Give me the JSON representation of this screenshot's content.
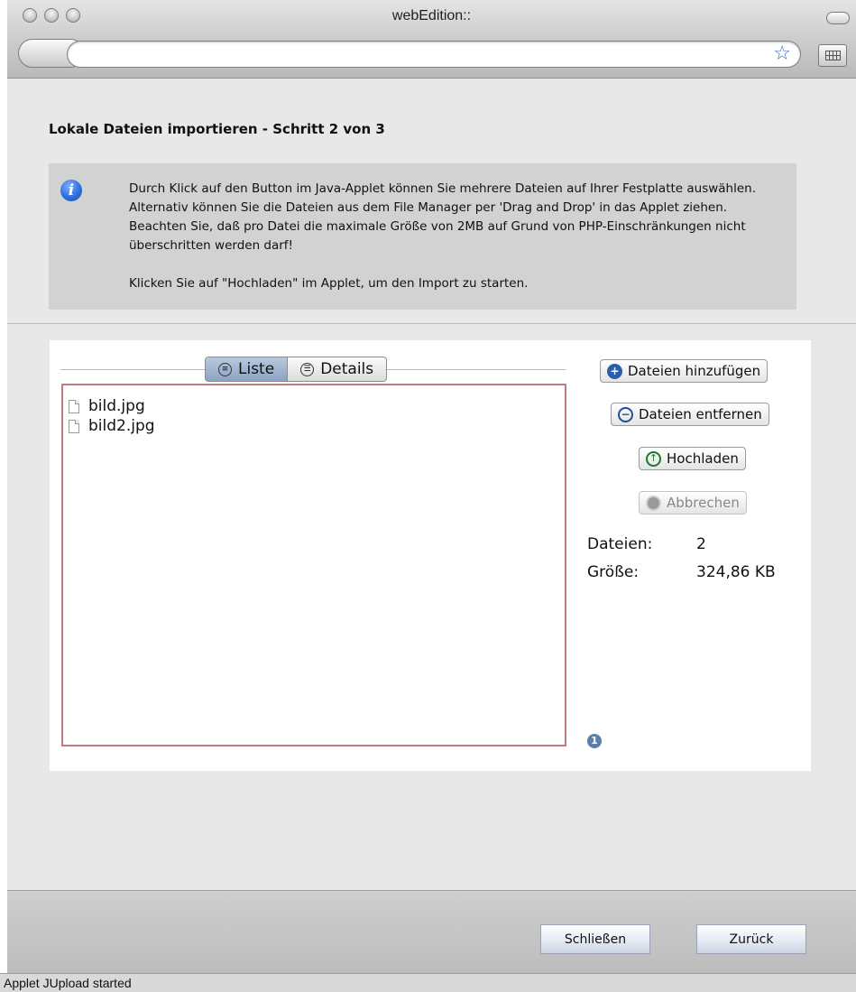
{
  "window": {
    "title": "webEdition::"
  },
  "toolbar": {
    "url": ""
  },
  "page": {
    "heading": "Lokale Dateien importieren - Schritt 2 von 3",
    "info": {
      "paragraph1": "Durch Klick auf den Button im Java-Applet können Sie mehrere Dateien auf Ihrer Festplatte auswählen. Alternativ können Sie die Dateien aus dem File Manager per 'Drag and Drop' in das Applet ziehen. Beachten Sie, daß pro Datei die maximale Größe von 2MB auf Grund von PHP-Einschränkungen nicht überschritten werden darf!",
      "paragraph2": "Klicken Sie auf \"Hochladen\" im Applet, um den Import zu starten."
    }
  },
  "applet": {
    "tabs": [
      {
        "label": "Liste",
        "selected": true
      },
      {
        "label": "Details",
        "selected": false
      }
    ],
    "files": [
      {
        "name": "bild.jpg"
      },
      {
        "name": "bild2.jpg"
      }
    ],
    "buttons": {
      "add": "Dateien hinzufügen",
      "remove": "Dateien entfernen",
      "upload": "Hochladen",
      "cancel": "Abbrechen"
    },
    "stats": {
      "files_label": "Dateien:",
      "files_value": "2",
      "size_label": "Größe:",
      "size_value": "324,86 KB"
    },
    "badge": "1"
  },
  "footer": {
    "close_label": "Schließen",
    "back_label": "Zurück"
  },
  "statusbar": {
    "text": "Applet JUpload started"
  },
  "colors": {
    "accent": "#2a5ea8",
    "list_border": "#c07a80",
    "info_bg": "#d2d2d2"
  }
}
